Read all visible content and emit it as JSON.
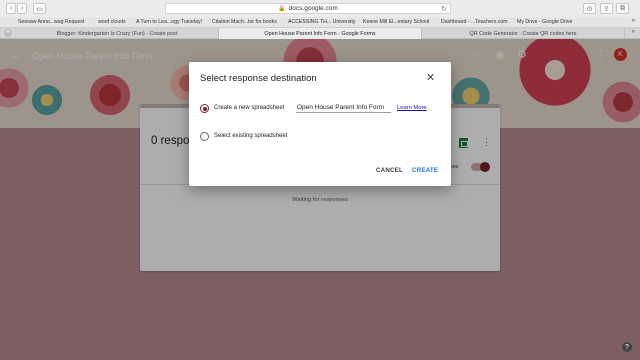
{
  "browser": {
    "address": "docs.google.com",
    "bookmarks": [
      "Seesaw Anno...wag Request",
      "word clouds",
      "A Turn to Lea...ogy Tuesday!",
      "Citation Mach...tor for books",
      "ACCESSING TH... University",
      "Keene Mill El...entary School",
      "Dashboard - ...Teachers.com",
      "My Drive - Google Drive"
    ],
    "tabs": [
      "Blogger: Kindergarten Is Crazy (Fun) - Create post",
      "Open House Parent Info Form - Google Forms",
      "QR Code Generator - Create QR codes here"
    ]
  },
  "forms": {
    "title": "Open House Parent Info Form",
    "avatar_letter": "K",
    "responses_count": "0 respo",
    "accepting_label": "ses",
    "waiting_text": "Waiting for responses"
  },
  "dialog": {
    "title": "Select response destination",
    "option_new": "Create a new spreadsheet",
    "spreadsheet_name": "Open House Parent Info Form",
    "learn_more": "Learn More",
    "option_existing": "Select existing spreadsheet",
    "cancel": "CANCEL",
    "create": "CREATE"
  },
  "colors": {
    "accent": "#7a1f25",
    "link": "#1a73e8",
    "sheets_green": "#188038"
  }
}
